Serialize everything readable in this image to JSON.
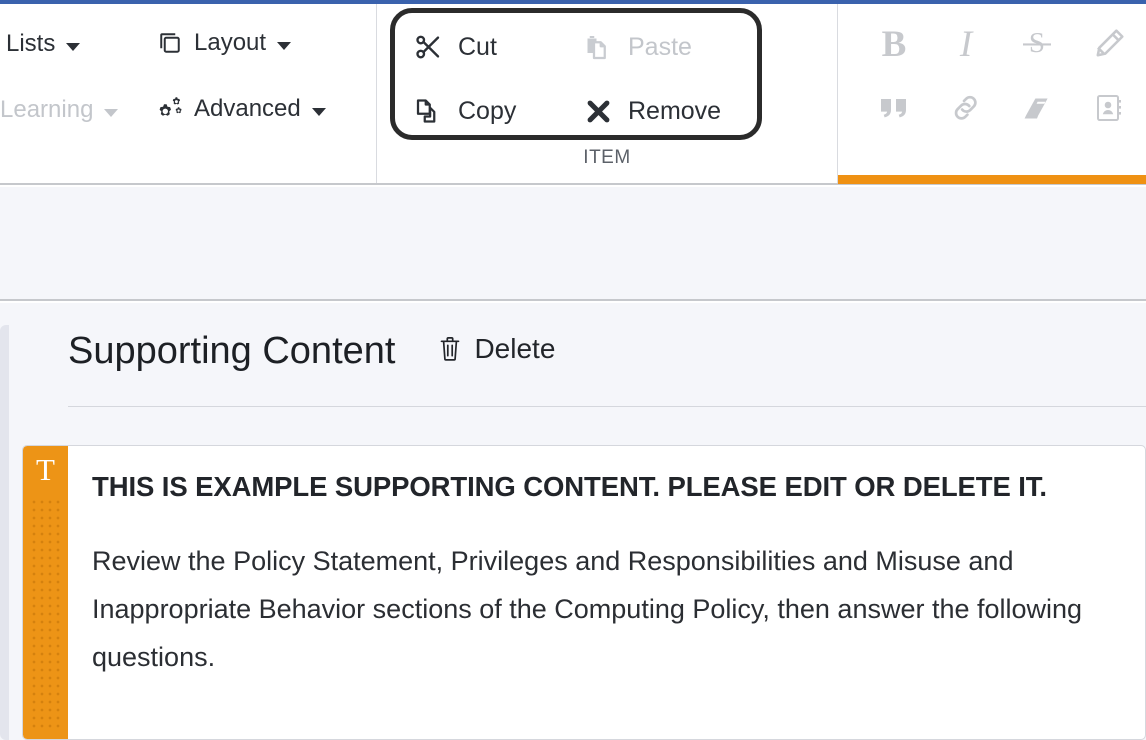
{
  "theme": {
    "accent_blue": "#3a62ad",
    "accent_orange": "#ed9416",
    "page_bg": "#f5f6fa",
    "text": "#22252a",
    "muted": "#c3c6cb"
  },
  "ribbon": {
    "menus": [
      {
        "label": "Lists",
        "icon": "",
        "caret": true,
        "disabled": false
      },
      {
        "label": "Learning",
        "icon": "",
        "caret": true,
        "disabled": true
      },
      {
        "label": "Layout",
        "icon": "copy-layout-icon",
        "caret": true,
        "disabled": false
      },
      {
        "label": "Advanced",
        "icon": "gears-icon",
        "caret": true,
        "disabled": false
      }
    ],
    "item_group": {
      "label": "ITEM",
      "commands": [
        {
          "label": "Cut",
          "icon": "scissors-icon",
          "disabled": false
        },
        {
          "label": "Copy",
          "icon": "copy-icon",
          "disabled": false
        },
        {
          "label": "Paste",
          "icon": "paste-icon",
          "disabled": true
        },
        {
          "label": "Remove",
          "icon": "x-mark-icon",
          "disabled": false
        }
      ],
      "move_up_icon": "arrow-up-icon",
      "move_down_icon": "arrow-down-icon"
    },
    "format_tools": [
      {
        "name": "bold",
        "glyph": "B",
        "icon": "bold-icon",
        "disabled": true
      },
      {
        "name": "italic",
        "glyph": "I",
        "icon": "italic-icon",
        "disabled": true
      },
      {
        "name": "strike",
        "glyph": "S",
        "icon": "strikethrough-icon",
        "disabled": true
      },
      {
        "name": "pencil",
        "glyph": "",
        "icon": "pencil-icon",
        "disabled": true
      },
      {
        "name": "blockquote",
        "glyph": "”",
        "icon": "quote-icon",
        "disabled": true
      },
      {
        "name": "link",
        "glyph": "",
        "icon": "link-icon",
        "disabled": true
      },
      {
        "name": "glossary",
        "glyph": "",
        "icon": "book-icon",
        "disabled": true
      },
      {
        "name": "contact",
        "glyph": "",
        "icon": "address-book-icon",
        "disabled": true
      }
    ]
  },
  "section": {
    "title": "Supporting Content",
    "delete_label": "Delete",
    "delete_icon": "trash-icon"
  },
  "card": {
    "type_glyph": "T",
    "type_name": "text-block",
    "lead": "THIS IS EXAMPLE SUPPORTING CONTENT. PLEASE EDIT OR DELETE IT.",
    "paragraph": "Review the Policy Statement, Privileges and Responsibilities and Misuse and Inappropriate Behavior sections of the Computing Policy, then answer the following questions."
  }
}
